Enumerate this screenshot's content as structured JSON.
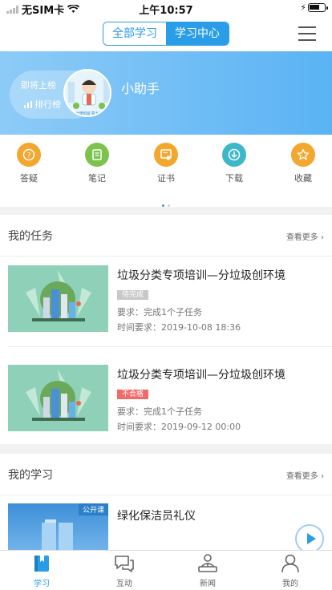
{
  "status_bar": {
    "carrier": "无SIM卡",
    "time": "上午10:57"
  },
  "header": {
    "segments": [
      {
        "label": "全部学习"
      },
      {
        "label": "学习中心"
      }
    ]
  },
  "profile": {
    "rank_top_label": "即将上榜",
    "rank_link": "排行榜",
    "name": "小助手",
    "avatar_caption": "共建和谐 靠大家"
  },
  "quick_actions": [
    {
      "label": "答疑",
      "icon": "question-icon",
      "color": "#f3a72e"
    },
    {
      "label": "笔记",
      "icon": "note-icon",
      "color": "#7cc24c"
    },
    {
      "label": "证书",
      "icon": "certificate-icon",
      "color": "#f3a72e"
    },
    {
      "label": "下载",
      "icon": "download-icon",
      "color": "#3db8c9"
    },
    {
      "label": "收藏",
      "icon": "star-icon",
      "color": "#f3a72e"
    }
  ],
  "tasks": {
    "title": "我的任务",
    "more": "查看更多",
    "items": [
      {
        "title": "垃圾分类专项培训—分垃圾创环境",
        "status": "待完成",
        "status_color": "#c8c8c8",
        "requirement": "要求：完成1个子任务",
        "due": "时间要求：2019-10-08 18:36"
      },
      {
        "title": "垃圾分类专项培训—分垃圾创环境",
        "status": "不合格",
        "status_color": "#f06a6a",
        "requirement": "要求：完成1个子任务",
        "due": "时间要求：2019-09-12 00:00"
      }
    ]
  },
  "learning": {
    "title": "我的学习",
    "more": "查看更多",
    "items": [
      {
        "title": "绿化保洁员礼仪",
        "tag": "公开课"
      }
    ]
  },
  "tabbar": [
    {
      "label": "学习",
      "icon": "book-icon",
      "active": true
    },
    {
      "label": "互动",
      "icon": "chat-icon",
      "active": false
    },
    {
      "label": "新闻",
      "icon": "news-icon",
      "active": false
    },
    {
      "label": "我的",
      "icon": "user-icon",
      "active": false
    }
  ],
  "colors": {
    "accent": "#2a9de8",
    "banner_start": "#8dcbf7",
    "banner_end": "#5ab3f4"
  }
}
